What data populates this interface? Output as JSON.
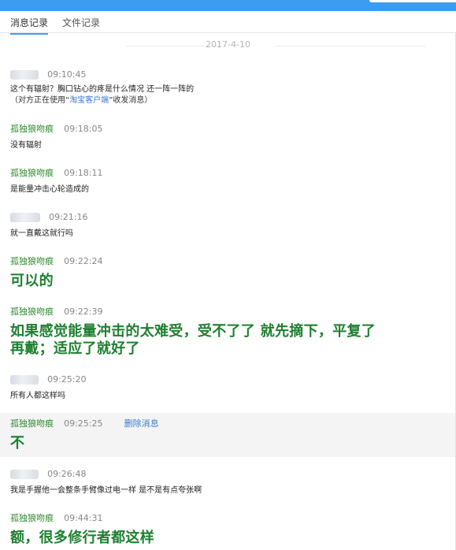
{
  "tabs": {
    "messages": "消息记录",
    "files": "文件记录"
  },
  "date_separator": "2017-4-10",
  "messages": [
    {
      "sender": "",
      "time": "09:10:45",
      "text": "这个有辐射？胸口钻心的疼是什么情况 还一阵一阵的",
      "note_prefix": "（对方正在使用“",
      "note_link": "淘宝客户端",
      "note_suffix": "”收发消息）"
    },
    {
      "sender": "孤独狼吻痕",
      "time": "09:18:05",
      "text": "没有辐射"
    },
    {
      "sender": "孤独狼吻痕",
      "time": "09:18:11",
      "text": "是能量冲击心轮造成的"
    },
    {
      "sender": "",
      "time": "09:21:16",
      "text": "就一直戴这就行吗"
    },
    {
      "sender": "孤独狼吻痕",
      "time": "09:22:24",
      "text": "可以的"
    },
    {
      "sender": "孤独狼吻痕",
      "time": "09:22:39",
      "text": "如果感觉能量冲击的太难受，受不了了 就先摘下，平复了\n再戴；适应了就好了"
    },
    {
      "sender": "",
      "time": "09:25:20",
      "text": "所有人都这样吗"
    },
    {
      "sender": "孤独狼吻痕",
      "time": "09:25:25",
      "text": "不",
      "action": "删除消息"
    },
    {
      "sender": "",
      "time": "09:26:48",
      "text": "我是手握他一会整条手臂像过电一样 是不是有点夸张啊"
    },
    {
      "sender": "孤独狼吻痕",
      "time": "09:44:31",
      "text": "额，很多修行者都这样"
    }
  ],
  "colors": {
    "accent": "#3c9df0",
    "seller_name": "#2e8b2e",
    "big_text": "#1e7f2f",
    "link": "#3a79c9"
  }
}
